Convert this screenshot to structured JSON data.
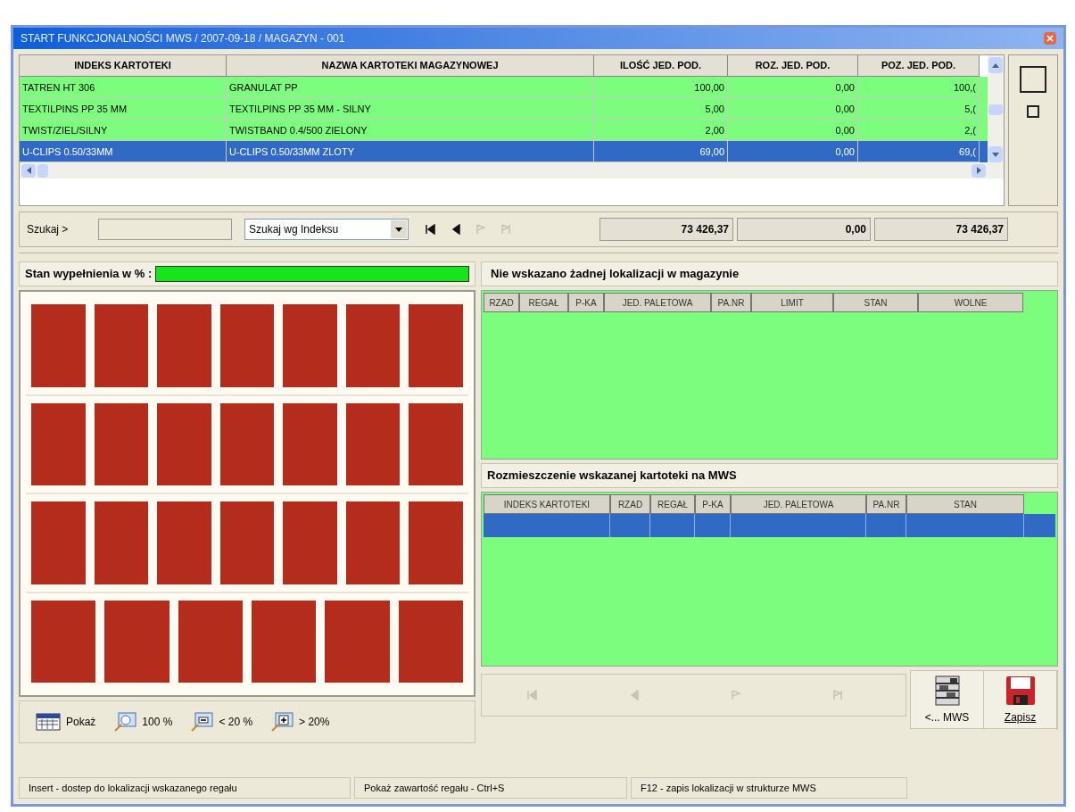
{
  "window": {
    "title": "START FUNKCJONALNOŚCI MWS / 2007-09-18 / MAGAZYN - 001"
  },
  "table": {
    "columns": [
      "INDEKS KARTOTEKI",
      "NAZWA  KARTOTEKI MAGAZYNOWEJ",
      "ILOŚĆ JED. POD.",
      "ROZ. JED. POD.",
      "POZ. JED. POD."
    ],
    "rows": [
      {
        "cells": [
          "TATREN HT 306",
          "GRANULAT PP",
          "100,00",
          "0,00",
          "100,("
        ],
        "selected": false
      },
      {
        "cells": [
          "TEXTILPINS PP 35 MM",
          "TEXTILPINS PP 35 MM - SILNY",
          "5,00",
          "0,00",
          "5,("
        ],
        "selected": false
      },
      {
        "cells": [
          "TWIST/ZIEL/SILNY",
          "TWISTBAND 0.4/500 ZIELONY",
          "2,00",
          "0,00",
          "2,("
        ],
        "selected": false
      },
      {
        "cells": [
          "U-CLIPS 0.50/33MM",
          "U-CLIPS 0.50/33MM ZLOTY",
          "69,00",
          "0,00",
          "69,("
        ],
        "selected": true
      }
    ]
  },
  "search": {
    "label": "Szukaj >",
    "mode": "Szukaj wg Indeksu",
    "nav": [
      {
        "kind": "first",
        "disabled": false
      },
      {
        "kind": "prev",
        "disabled": false
      },
      {
        "kind": "next",
        "disabled": true
      },
      {
        "kind": "last",
        "disabled": true
      }
    ],
    "totals": [
      "73 426,37",
      "0,00",
      "73 426,37"
    ]
  },
  "fill": {
    "label": "Stan wypełnienia w % :",
    "level": 1.0
  },
  "rack_rows": [
    {
      "slots": [
        {
          "occupied": true
        },
        {
          "occupied": true
        },
        {
          "occupied": true
        },
        {
          "occupied": true
        },
        {
          "occupied": true
        },
        {
          "occupied": true
        },
        {
          "occupied": true
        }
      ]
    },
    {
      "slots": [
        {
          "occupied": true
        },
        {
          "occupied": true
        },
        {
          "occupied": true
        },
        {
          "occupied": true
        },
        {
          "occupied": true
        },
        {
          "occupied": true
        },
        {
          "occupied": true
        }
      ]
    },
    {
      "slots": [
        {
          "occupied": true
        },
        {
          "occupied": true
        },
        {
          "occupied": true
        },
        {
          "occupied": true
        },
        {
          "occupied": true
        },
        {
          "occupied": true
        },
        {
          "occupied": true
        }
      ]
    },
    {
      "slots": [
        {
          "occupied": true
        },
        {
          "occupied": true
        },
        {
          "occupied": true
        },
        {
          "occupied": true
        },
        {
          "occupied": true
        },
        {
          "occupied": true
        }
      ]
    }
  ],
  "locations": {
    "title": "Nie wskazano żadnej lokalizacji w magazynie",
    "columns": [
      "RZAD",
      "REGAŁ",
      "P-KA",
      "JED. PALETOWA",
      "PA.NR",
      "LIMIT",
      "STAN",
      "WOLNE"
    ]
  },
  "placement": {
    "title": "Rozmieszczenie wskazanej kartoteki na MWS",
    "columns": [
      "INDEKS KARTOTEKI",
      "RZAD",
      "REGAŁ",
      "P-KA",
      "JED. PALETOWA",
      "PA.NR",
      "STAN"
    ]
  },
  "view_buttons": [
    {
      "kind": "show",
      "label": "Pokaż"
    },
    {
      "kind": "zoom",
      "label": "100 %"
    },
    {
      "kind": "zoom-out",
      "label": "< 20 %"
    },
    {
      "kind": "zoom-in",
      "label": "> 20%"
    }
  ],
  "bottom_nav": [
    {
      "kind": "first",
      "disabled": true
    },
    {
      "kind": "prev",
      "disabled": true
    },
    {
      "kind": "next",
      "disabled": true
    },
    {
      "kind": "last",
      "disabled": true
    }
  ],
  "action_buttons": [
    {
      "kind": "mws",
      "label": "<... MWS"
    },
    {
      "kind": "save",
      "label": "Zapisz"
    }
  ],
  "status_bar": [
    "Insert - dostep do lokalizacji wskazanego regału",
    "Pokaż zawartość regału - Ctrl+S",
    "F12 - zapis lokalizacji w strukturze MWS"
  ]
}
